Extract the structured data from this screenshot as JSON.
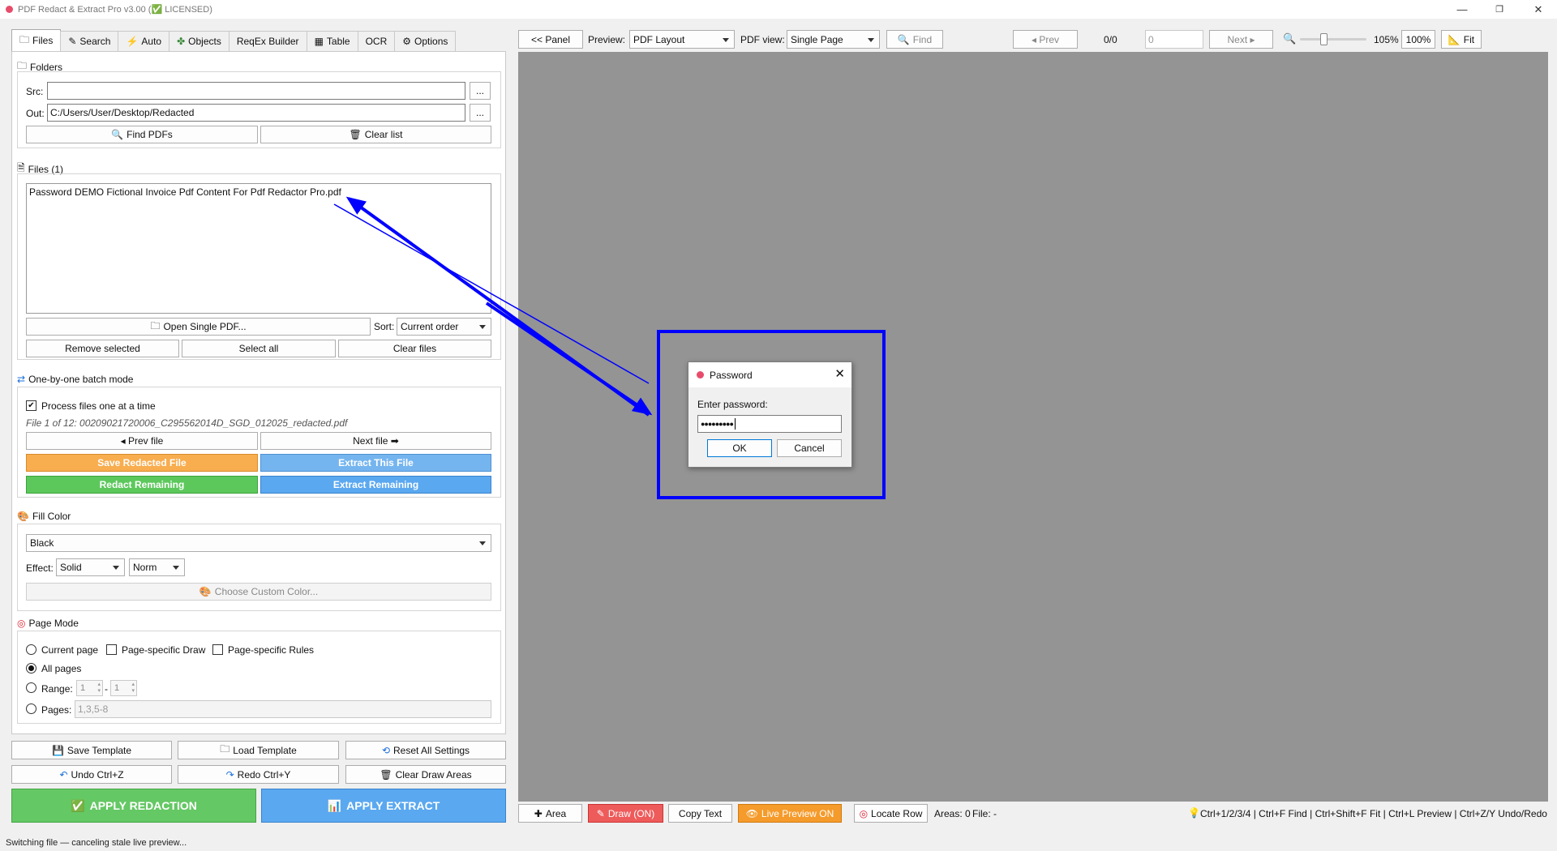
{
  "window": {
    "title": "PDF Redact & Extract Pro v3.00 (✅ LICENSED)",
    "minimize": "—",
    "maximize": "❐",
    "close": "✕"
  },
  "tabs": [
    {
      "label": "Files",
      "icon": "folder-icon"
    },
    {
      "label": "Search",
      "icon": "pencil-icon"
    },
    {
      "label": "Auto",
      "icon": "lightning-icon"
    },
    {
      "label": "Objects",
      "icon": "objects-icon"
    },
    {
      "label": "ReqEx Builder",
      "icon": ""
    },
    {
      "label": "Table",
      "icon": "table-icon"
    },
    {
      "label": "OCR",
      "icon": ""
    },
    {
      "label": "Options",
      "icon": "gear-icon"
    }
  ],
  "folders": {
    "heading": "Folders",
    "src_label": "Src:",
    "src_value": "",
    "out_label": "Out:",
    "out_value": "C:/Users/User/Desktop/Redacted",
    "browse": "...",
    "find_pdfs": "Find PDFs",
    "clear_list": "Clear list"
  },
  "files": {
    "heading": "Files (1)",
    "list": [
      "Password DEMO Fictional Invoice Pdf Content For Pdf Redactor Pro.pdf"
    ],
    "open_single": "Open Single PDF...",
    "sort_label": "Sort:",
    "sort_value": "Current order",
    "remove_selected": "Remove selected",
    "select_all": "Select all",
    "clear_files": "Clear files"
  },
  "batch": {
    "heading": "One-by-one batch mode",
    "process_label": "Process files one at a time",
    "process_checked": true,
    "file_info": "File 1 of 12: 00209021720006_C295562014D_SGD_012025_redacted.pdf",
    "prev_file": "◂ Prev file",
    "next_file": "Next file ➡",
    "save_redacted": "Save Redacted File",
    "extract_this": "Extract This File",
    "redact_remaining": "Redact Remaining",
    "extract_remaining": "Extract Remaining"
  },
  "fill": {
    "heading": "Fill Color",
    "color_value": "Black",
    "effect_label": "Effect:",
    "effect_value": "Solid",
    "norm_value": "Norm",
    "choose_custom": "Choose Custom Color..."
  },
  "page_mode": {
    "heading": "Page Mode",
    "current_page": "Current page",
    "page_specific_draw": "Page-specific Draw",
    "page_specific_rules": "Page-specific Rules",
    "all_pages": "All pages",
    "range_label": "Range:",
    "range_from": "1",
    "range_sep": "-",
    "range_to": "1",
    "pages_label": "Pages:",
    "pages_placeholder": "1,3,5-8",
    "selected": "All pages"
  },
  "bottom": {
    "save_template": "Save Template",
    "load_template": "Load Template",
    "reset_all": "Reset All Settings",
    "undo": "Undo  Ctrl+Z",
    "redo": "Redo  Ctrl+Y",
    "clear_draw": "Clear Draw Areas",
    "apply_redaction": "APPLY REDACTION",
    "apply_extract": "APPLY EXTRACT"
  },
  "toolbar": {
    "panel": "<< Panel",
    "preview_label": "Preview:",
    "preview_value": "PDF Layout",
    "pdfview_label": "PDF view:",
    "pdfview_value": "Single Page",
    "find": "Find",
    "prev": "◂ Prev",
    "count": "0/0",
    "page_input": "0",
    "next": "Next ▸",
    "zoom_value": "105%",
    "zoom_percent": 0.35,
    "zoom_100": "100%",
    "fit": "Fit"
  },
  "dialog": {
    "title": "Password",
    "prompt": "Enter password:",
    "password_value": "●●●●●●●●●",
    "ok": "OK",
    "cancel": "Cancel"
  },
  "bottombar": {
    "area": "Area",
    "draw": "Draw (ON)",
    "copy_text": "Copy Text",
    "live_preview": "Live Preview ON",
    "locate_row": "Locate Row",
    "areas": "Areas: 0",
    "file": "File: -",
    "shortcuts": "Ctrl+1/2/3/4 | Ctrl+F Find | Ctrl+Shift+F Fit | Ctrl+L Preview | Ctrl+Z/Y Undo/Redo"
  },
  "status": "Switching file — canceling stale live preview...",
  "colors": {
    "orange": "#f8ad4f",
    "blue": "#75b5ef",
    "green": "#5cc85c",
    "apply_green": "#64c864",
    "apply_blue": "#5aa8f0",
    "draw_red": "#ee5b5b",
    "live_orange": "#f59b2b",
    "annotation_blue": "#0000ff",
    "preview_gray": "#949494"
  }
}
